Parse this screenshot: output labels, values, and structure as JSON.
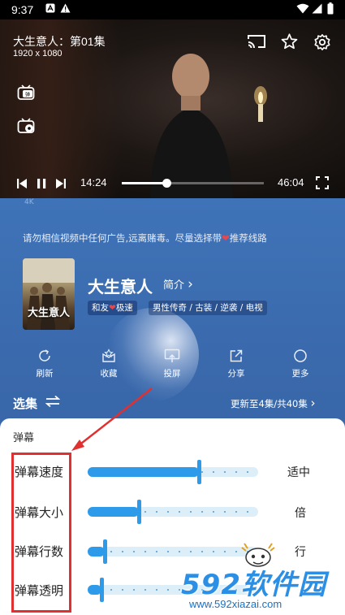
{
  "status_bar": {
    "time": "9:37"
  },
  "player": {
    "title": "大生意人：第01集",
    "resolution": "1920 x 1080",
    "current_time": "14:24",
    "duration": "46:04",
    "progress_fraction": 0.313
  },
  "main": {
    "quality_badge": "4K",
    "notice_before": "请勿相信视频中任何广告,远离赌毒。尽量选择带",
    "notice_heart": "❤",
    "notice_after": "推荐线路",
    "poster_title": "大生意人",
    "show_title": "大生意人",
    "intro_label": "简介",
    "intro_chevron": "›",
    "tag_source_a": "和友",
    "tag_source_heart": "❤",
    "tag_source_b": "极速",
    "tag_genre": "男性传奇 / 古装 / 逆袭 / 电视",
    "actions": [
      {
        "label": "刷新",
        "icon": "refresh-icon"
      },
      {
        "label": "收藏",
        "icon": "collect-icon"
      },
      {
        "label": "投屏",
        "icon": "cast-icon"
      },
      {
        "label": "分享",
        "icon": "share-icon"
      },
      {
        "label": "更多",
        "icon": "more-icon"
      }
    ],
    "episodes_label": "选集",
    "update_text": "更新至4集/共40集",
    "update_chevron": "›"
  },
  "danmaku_panel": {
    "title": "弹幕",
    "rows": [
      {
        "label": "弹幕速度",
        "value_label": "适中",
        "level": 0.65
      },
      {
        "label": "弹幕大小",
        "value_label": "倍",
        "level": 0.3
      },
      {
        "label": "弹幕行数",
        "value_label": "行",
        "level": 0.1
      },
      {
        "label": "弹幕透明",
        "value_label": "",
        "level": 0.08
      }
    ]
  },
  "watermark": {
    "brand": "592软件园",
    "url": "www.592xiazai.com"
  },
  "colors": {
    "accent": "#2e9bea",
    "panel_bg": "#ffffff",
    "main_bg": "#3f73b8",
    "annotation_red": "#e03030"
  }
}
